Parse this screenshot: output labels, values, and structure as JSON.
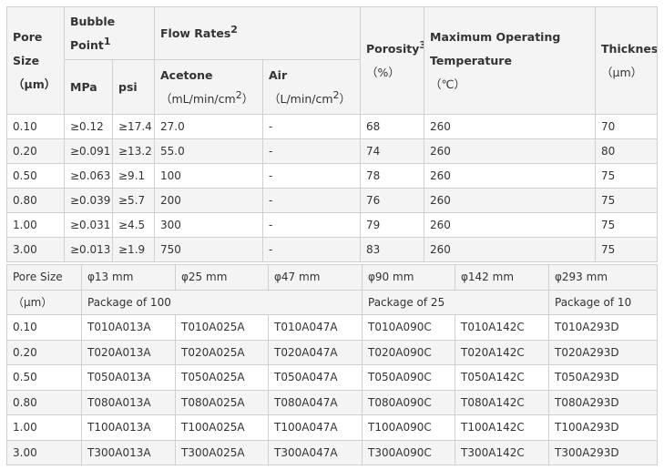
{
  "spec": {
    "header": {
      "pore_size": [
        "Pore",
        "Size",
        "（μm）"
      ],
      "bubble_point": [
        "Bubble",
        "Point"
      ],
      "bubble_point_sup": "1",
      "mpa": "MPa",
      "psi": "psi",
      "flow_rates": "Flow Rates",
      "flow_rates_sup": "2",
      "acetone": "Acetone",
      "acetone_unit_pre": "（mL/min/cm",
      "acetone_unit_sup": "2",
      "acetone_unit_post": "）",
      "air": "Air",
      "air_unit_pre": "（L/min/cm",
      "air_unit_sup": "2",
      "air_unit_post": "）",
      "porosity": "Porosity",
      "porosity_sup": "3",
      "porosity_unit": "（%）",
      "max_temp": [
        "Maximum Operating",
        "Temperature",
        "（℃）"
      ],
      "thickness": "Thickness",
      "thickness_unit": "（μm）"
    },
    "rows": [
      {
        "pore": "0.10",
        "mpa": "≥0.12",
        "psi": "≥17.4",
        "acetone": "27.0",
        "air": "-",
        "porosity": "68",
        "temp": "260",
        "thickness": "70"
      },
      {
        "pore": "0.20",
        "mpa": "≥0.091",
        "psi": "≥13.2",
        "acetone": "55.0",
        "air": "-",
        "porosity": "74",
        "temp": "260",
        "thickness": "80"
      },
      {
        "pore": "0.50",
        "mpa": "≥0.063",
        "psi": "≥9.1",
        "acetone": "100",
        "air": "-",
        "porosity": "78",
        "temp": "260",
        "thickness": "75"
      },
      {
        "pore": "0.80",
        "mpa": "≥0.039",
        "psi": "≥5.7",
        "acetone": "200",
        "air": "-",
        "porosity": "76",
        "temp": "260",
        "thickness": "75"
      },
      {
        "pore": "1.00",
        "mpa": "≥0.031",
        "psi": "≥4.5",
        "acetone": "300",
        "air": "-",
        "porosity": "79",
        "temp": "260",
        "thickness": "75"
      },
      {
        "pore": "3.00",
        "mpa": "≥0.013",
        "psi": "≥1.9",
        "acetone": "750",
        "air": "-",
        "porosity": "83",
        "temp": "260",
        "thickness": "75"
      }
    ]
  },
  "catalog": {
    "header": {
      "pore_size": "Pore Size",
      "pore_unit": "（μm）",
      "sizes": [
        "φ13 mm",
        "φ25 mm",
        "φ47 mm",
        "φ90 mm",
        "φ142 mm",
        "φ293 mm"
      ],
      "pkg_100": "Package of 100",
      "pkg_25": "Package of 25",
      "pkg_10": "Package of 10"
    },
    "rows": [
      {
        "pore": "0.10",
        "codes": [
          "T010A013A",
          "T010A025A",
          "T010A047A",
          "T010A090C",
          "T010A142C",
          "T010A293D"
        ]
      },
      {
        "pore": "0.20",
        "codes": [
          "T020A013A",
          "T020A025A",
          "T020A047A",
          "T020A090C",
          "T020A142C",
          "T020A293D"
        ]
      },
      {
        "pore": "0.50",
        "codes": [
          "T050A013A",
          "T050A025A",
          "T050A047A",
          "T050A090C",
          "T050A142C",
          "T050A293D"
        ]
      },
      {
        "pore": "0.80",
        "codes": [
          "T080A013A",
          "T080A025A",
          "T080A047A",
          "T080A090C",
          "T080A142C",
          "T080A293D"
        ]
      },
      {
        "pore": "1.00",
        "codes": [
          "T100A013A",
          "T100A025A",
          "T100A047A",
          "T100A090C",
          "T100A142C",
          "T100A293D"
        ]
      },
      {
        "pore": "3.00",
        "codes": [
          "T300A013A",
          "T300A025A",
          "T300A047A",
          "T300A090C",
          "T300A142C",
          "T300A293D"
        ]
      }
    ]
  }
}
